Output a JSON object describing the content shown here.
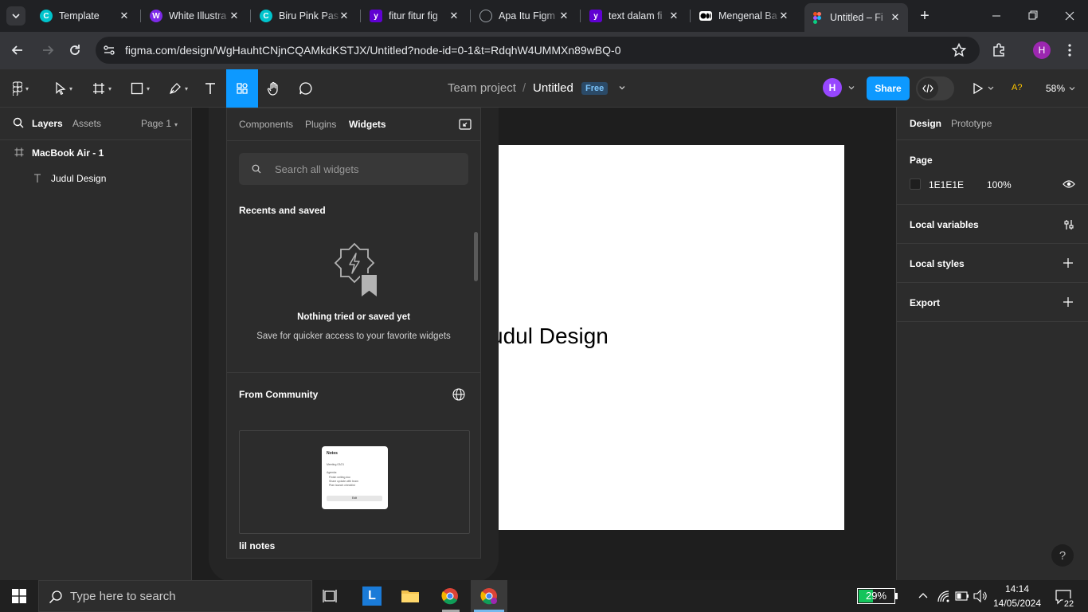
{
  "browser": {
    "tabs": [
      {
        "title": "Template",
        "fav_color": "#00c4cc",
        "fav_char": "C"
      },
      {
        "title": "White Illustra",
        "fav_color": "#7d2ae8",
        "fav_char": "W"
      },
      {
        "title": "Biru Pink Pas",
        "fav_color": "#00c4cc",
        "fav_char": "C"
      },
      {
        "title": "fitur fitur fig",
        "fav_color": "#6001d2",
        "fav_char": "y"
      },
      {
        "title": "Apa Itu Figm",
        "fav_color": "#9aa0a6",
        "fav_char": ""
      },
      {
        "title": "text dalam fi",
        "fav_color": "#6001d2",
        "fav_char": "y"
      },
      {
        "title": "Mengenal Ba",
        "fav_color": "#ffffff",
        "fav_char": ""
      },
      {
        "title": "Untitled – Fi",
        "fav_color": "#f24e1e",
        "fav_char": ""
      }
    ],
    "url": "figma.com/design/WgHauhtCNjnCQAMkdKSTJX/Untitled?node-id=0-1&t=RdqhW4UMMXn89wBQ-0",
    "profile_initial": "H"
  },
  "figma": {
    "breadcrumb": {
      "team": "Team project",
      "separator": "/",
      "file": "Untitled",
      "plan_badge": "Free"
    },
    "avatar_initial": "H",
    "share_label": "Share",
    "zoom": "58%",
    "left_tabs": {
      "layers": "Layers",
      "assets": "Assets",
      "page": "Page 1"
    },
    "layers": [
      {
        "name": "MacBook Air - 1",
        "type": "frame"
      },
      {
        "name": "Judul Design",
        "type": "text"
      }
    ],
    "canvas_text": "Judul Design",
    "right_tabs": {
      "design": "Design",
      "prototype": "Prototype"
    },
    "page_section": {
      "title": "Page",
      "color_hex": "1E1E1E",
      "opacity": "100%"
    },
    "sections": [
      "Local variables",
      "Local styles",
      "Export"
    ],
    "help": "?"
  },
  "widgets_panel": {
    "tabs": [
      "Components",
      "Plugins",
      "Widgets"
    ],
    "active_tab": "Widgets",
    "search_placeholder": "Search all widgets",
    "recents_title": "Recents and saved",
    "empty_title": "Nothing tried or saved yet",
    "empty_subtitle": "Save for quicker access to your favorite widgets",
    "community_title": "From Community",
    "card_name": "lil notes",
    "card_preview": {
      "title": "Notes",
      "line1": "Meeting 03/21",
      "line2": "Agenda:",
      "bullets": [
        "Finish writing doc",
        "Share update with team",
        "Plan launch checklist"
      ],
      "button": "Edit"
    }
  },
  "taskbar": {
    "search_placeholder": "Type here to search",
    "battery": "29%",
    "time": "14:14",
    "date": "14/05/2024",
    "notifications": "22"
  },
  "colors": {
    "accent": "#0d99ff",
    "figma_bg": "#2c2c2c",
    "canvas_bg": "#1e1e1e",
    "avatar": "#9747ff"
  }
}
